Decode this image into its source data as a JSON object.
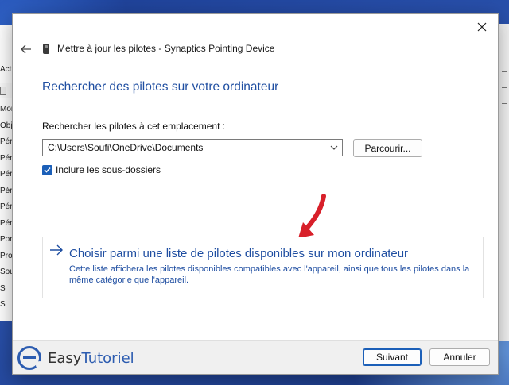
{
  "background_window": {
    "menu_fragment": "Actio",
    "tree_fragments": [
      "Mor",
      "Obje",
      "Péri",
      "Péri",
      "Péri",
      "Péri",
      "Péri",
      "Péri",
      "Port",
      "Proc",
      "Sour",
      "S",
      "S"
    ]
  },
  "dialog": {
    "header_title": "Mettre à jour les pilotes - Synaptics Pointing Device",
    "main_heading": "Rechercher des pilotes sur votre ordinateur",
    "location_label": "Rechercher les pilotes à cet emplacement :",
    "path_value": "C:\\Users\\Soufi\\OneDrive\\Documents",
    "browse_label": "Parcourir...",
    "include_subfolders_label": "Inclure les sous-dossiers",
    "include_subfolders_checked": true,
    "choose_list": {
      "title": "Choisir parmi une liste de pilotes disponibles sur mon ordinateur",
      "description": "Cette liste affichera les pilotes disponibles compatibles avec l'appareil, ainsi que tous les pilotes dans la même catégorie que l'appareil."
    },
    "footer": {
      "logo_text_part1": "Easy",
      "logo_text_part2": "Tutoriel",
      "next_label": "Suivant",
      "cancel_label": "Annuler"
    }
  },
  "icons": {
    "close": "close-icon",
    "back": "back-arrow-icon",
    "device": "mouse-device-icon",
    "dropdown": "chevron-down-icon",
    "checkbox": "checkmark-icon",
    "link_arrow": "right-arrow-icon",
    "annotation": "red-arrow-annotation"
  },
  "colors": {
    "accent_blue": "#1f4ea1",
    "checkbox_blue": "#1b5fb8",
    "annotation_red": "#d8202a"
  }
}
